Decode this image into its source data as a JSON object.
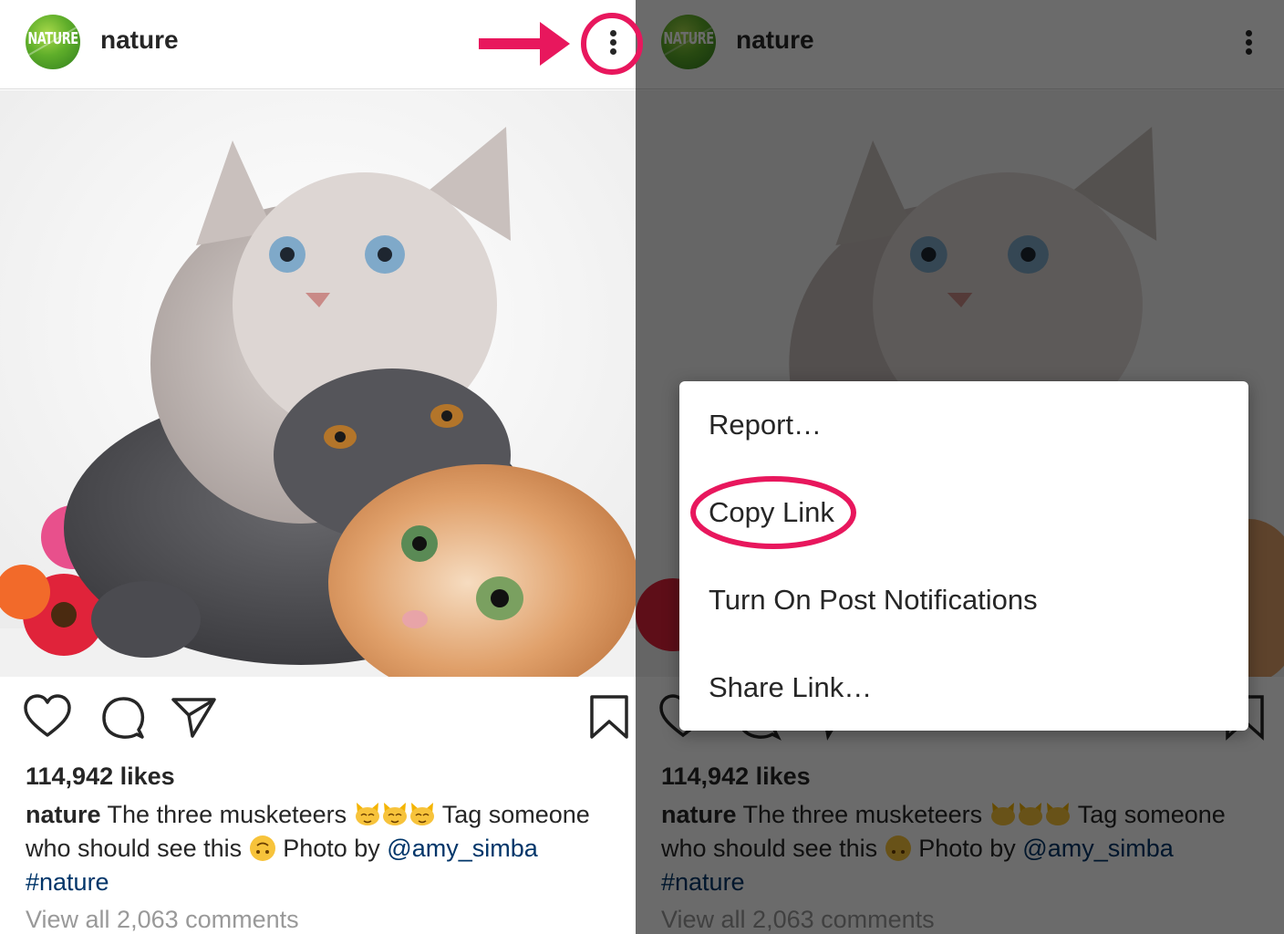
{
  "post": {
    "username": "nature",
    "avatar_text": "NATURE",
    "likes": "114,942 likes",
    "caption": {
      "user": "nature",
      "text_1": "The three musketeers",
      "text_2": "Tag someone who should see this",
      "text_3": "Photo by",
      "mention": "@amy_simba",
      "hashtag": "#nature"
    },
    "comments_link": "View all 2,063 comments"
  },
  "icons": {
    "more": "more-vertical-icon",
    "like": "heart-icon",
    "comment": "comment-icon",
    "share": "send-icon",
    "save": "bookmark-icon",
    "caption_emojis": [
      "cat-emoji",
      "cat-emoji",
      "cat-emoji",
      "upside-down-face-emoji"
    ]
  },
  "menu": {
    "items": [
      "Report…",
      "Copy Link",
      "Turn On Post Notifications",
      "Share Link…"
    ]
  },
  "colors": {
    "annotation": "#e8175d",
    "link": "#003569",
    "muted": "#999999",
    "overlay": "rgba(0,0,0,0.58)"
  }
}
